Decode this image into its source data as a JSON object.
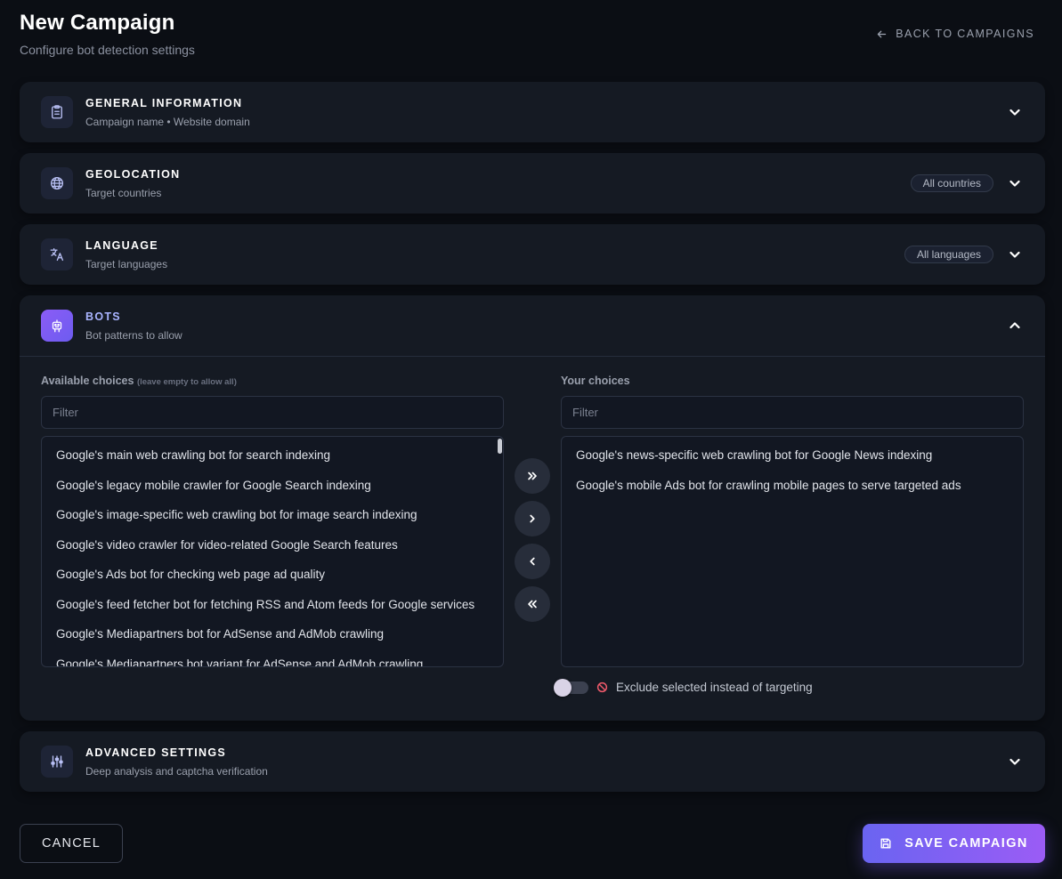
{
  "page": {
    "title": "New Campaign",
    "subtitle": "Configure bot detection settings",
    "back_link": "BACK TO CAMPAIGNS"
  },
  "sections": {
    "general": {
      "title": "GENERAL INFORMATION",
      "subtitle": "Campaign name • Website domain",
      "icon": "clipboard-icon"
    },
    "geo": {
      "title": "GEOLOCATION",
      "subtitle": "Target countries",
      "badge": "All countries",
      "icon": "globe-icon"
    },
    "language": {
      "title": "LANGUAGE",
      "subtitle": "Target languages",
      "badge": "All languages",
      "icon": "translate-icon"
    },
    "bots": {
      "title": "BOTS",
      "subtitle": "Bot patterns to allow",
      "icon": "robot-icon",
      "available_label": "Available choices",
      "available_hint": "(leave empty to allow all)",
      "chosen_label": "Your choices",
      "filter_placeholder": "Filter",
      "available": [
        "Google's main web crawling bot for search indexing",
        "Google's legacy mobile crawler for Google Search indexing",
        "Google's image-specific web crawling bot for image search indexing",
        "Google's video crawler for video-related Google Search features",
        "Google's Ads bot for checking web page ad quality",
        "Google's feed fetcher bot for fetching RSS and Atom feeds for Google services",
        "Google's Mediapartners bot for AdSense and AdMob crawling",
        "Google's Mediapartners bot variant for AdSense and AdMob crawling"
      ],
      "chosen": [
        "Google's news-specific web crawling bot for Google News indexing",
        "Google's mobile Ads bot for crawling mobile pages to serve targeted ads"
      ],
      "exclude_label": "Exclude selected instead of targeting",
      "exclude_enabled": false
    },
    "advanced": {
      "title": "ADVANCED SETTINGS",
      "subtitle": "Deep analysis and captcha verification",
      "icon": "sliders-icon"
    }
  },
  "footer": {
    "cancel_label": "CANCEL",
    "save_label": "SAVE CAMPAIGN"
  },
  "colors": {
    "background": "#0b0e14",
    "card": "#151a23",
    "accent": "#7c5cf5",
    "danger": "#f05a6b"
  }
}
